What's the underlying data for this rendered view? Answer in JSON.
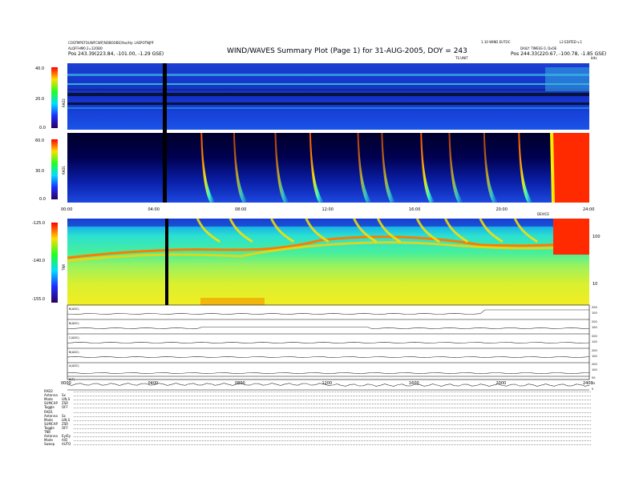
{
  "header": {
    "title": "WIND/WAVES Summary Plot (Page 1) for 31-AUG-2005, DOY = 243",
    "left_line1": "COSTMPSTOUWFCWF[NOBOOBS]Yoo/Hy: LAEPOTNJPF",
    "left_line2": "ALQFFHM0.2=12OBO",
    "left_line3": "Pos    243.39(223.84, -101.00, -1.29 GSE)",
    "right_line1": "1.10 WIND EUTOC",
    "right_line1b": "L2 EDITED v.1",
    "right_line2": "DAILY: TIMESS 0, DxOE",
    "right_line3": "Pos    244.33(220.67, -100.78, -1.85 GSE)",
    "units_note": "TS UNIT",
    "units_note_right": "kHz"
  },
  "panels": {
    "rad2_label": "RAD2",
    "rad1_label": "RAD1",
    "tnr_label": "TNR",
    "rad2_ticks": [
      "40.0",
      "20.0",
      "0.0"
    ],
    "rad1_ticks": [
      "60.0",
      "30.0",
      "0.0"
    ],
    "tnr_ticks": [
      "-125.0",
      "-140.0",
      "-155.0"
    ],
    "tnr_right_ticks": [
      "100",
      "10"
    ],
    "tnr_top_note": "DEVICE",
    "mid_time_ticks": [
      "00:00",
      "04:00",
      "08:00",
      "12:00",
      "16:00",
      "20:00",
      "24:00"
    ],
    "bottom_time_ticks": [
      "0000",
      "0400",
      "0800",
      "1200",
      "1600",
      "2000",
      "2400"
    ]
  },
  "chart_data": {
    "type": "heatmap",
    "title": "WIND/WAVES Summary Plot (Page 1) for 31-AUG-2005, DOY = 243",
    "x": [
      "00:00",
      "04:00",
      "08:00",
      "12:00",
      "16:00",
      "20:00",
      "24:00"
    ],
    "xlim": [
      "00:00",
      "24:00"
    ],
    "spectrograms": [
      {
        "name": "RAD2",
        "ylim": [
          0,
          40
        ],
        "ticks": [
          0,
          20,
          40
        ]
      },
      {
        "name": "RAD1",
        "ylim": [
          0,
          60
        ],
        "ticks": [
          0,
          30,
          60
        ]
      },
      {
        "name": "TNR",
        "ylim": [
          -155,
          -125
        ],
        "ticks": [
          -155,
          -140,
          -125
        ],
        "right_ticks": [
          10,
          100
        ]
      }
    ],
    "type_iii_burst_times_hr": [
      6.2,
      7.7,
      9.6,
      11.2,
      13.4,
      14.5,
      16.3,
      17.6,
      19.2,
      20.8
    ],
    "data_gap_hr": 4.4,
    "storm_start_hr": 22.4,
    "line_plots": [
      {
        "name": "B(ADC)",
        "right_ticks": [
          "200",
          "100"
        ]
      },
      {
        "name": "B(ADC)",
        "right_ticks": [
          "200",
          "100"
        ]
      },
      {
        "name": "C(ADC)",
        "right_ticks": [
          "200",
          "100"
        ]
      },
      {
        "name": "B(ADC)",
        "right_ticks": [
          "200",
          "100"
        ]
      },
      {
        "name": "A(ADC)",
        "right_ticks": [
          "200",
          "100"
        ]
      },
      {
        "name": "B(T)",
        "right_ticks": [
          "50",
          "25",
          "0"
        ]
      }
    ]
  },
  "footer_rows": [
    {
      "label": "RAD2",
      "value": ""
    },
    {
      "label": "Antenna",
      "value": "Sx"
    },
    {
      "label": "Mode",
      "value": "LIN,S"
    },
    {
      "label": "SUMCAP",
      "value": "ZSR"
    },
    {
      "label": "Toggle",
      "value": "OFF"
    },
    {
      "label": "RAD1",
      "value": ""
    },
    {
      "label": "Antenna",
      "value": "Sx"
    },
    {
      "label": "Mode",
      "value": "LIN,S"
    },
    {
      "label": "SUMCAP",
      "value": "ZSR"
    },
    {
      "label": "Toggle",
      "value": "OFF"
    },
    {
      "label": "TNR",
      "value": ""
    },
    {
      "label": "Antenna",
      "value": "Ey/Ey"
    },
    {
      "label": "Mode",
      "value": "A/D"
    },
    {
      "label": "Sweep",
      "value": "AUTO"
    }
  ],
  "colors": {
    "bg_dark": "#000033",
    "rad_base": "#1535d8",
    "tnr_base": "#35d8a8",
    "tnr_line": "#ff7a00",
    "storm": "#ff2a00"
  }
}
